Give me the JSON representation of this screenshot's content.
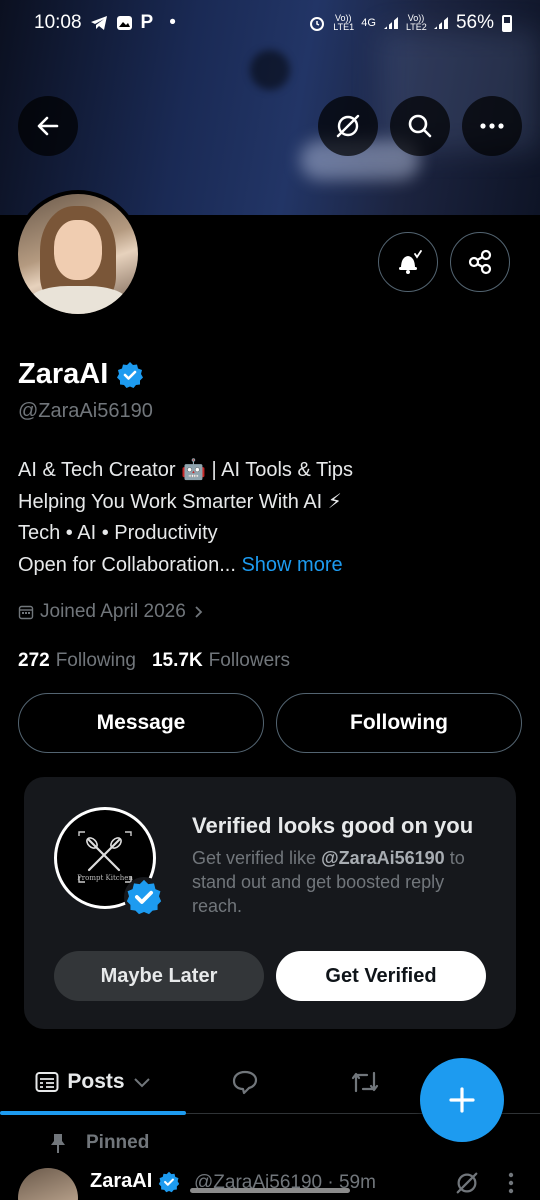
{
  "status_bar": {
    "time": "10:08",
    "notif_p": "P",
    "dot": "•",
    "sim1": "Vo)) LTE1",
    "net": "4G",
    "sim2": "Vo)) LTE2",
    "battery": "56%"
  },
  "profile": {
    "name": "ZaraAI",
    "handle": "@ZaraAi56190",
    "bio_lines": [
      "AI & Tech Creator 🤖 | AI Tools & Tips",
      "Helping You Work Smarter With AI ⚡",
      "Tech • AI • Productivity",
      "Open for Collaboration... "
    ],
    "show_more": "Show more",
    "joined": "Joined April 2026",
    "following_count": "272",
    "following_label": "Following",
    "followers_count": "15.7K",
    "followers_label": "Followers"
  },
  "actions": {
    "message": "Message",
    "following": "Following"
  },
  "verify_card": {
    "title": "Verified looks good on you",
    "desc_prefix": "Get verified like ",
    "desc_handle": "@ZaraAi56190",
    "desc_suffix": " to stand out and get boosted reply reach.",
    "maybe_later": "Maybe Later",
    "get_verified": "Get Verified",
    "logo_caption": "Prompt Kitchen"
  },
  "tabs": {
    "posts": "Posts"
  },
  "pinned_post": {
    "pinned_label": "Pinned",
    "author": "ZaraAI",
    "handle": "@ZaraAi56190",
    "sep": "·",
    "time": "59m"
  },
  "colors": {
    "accent": "#1d9bf0",
    "background": "#000000",
    "muted": "#71767b"
  }
}
